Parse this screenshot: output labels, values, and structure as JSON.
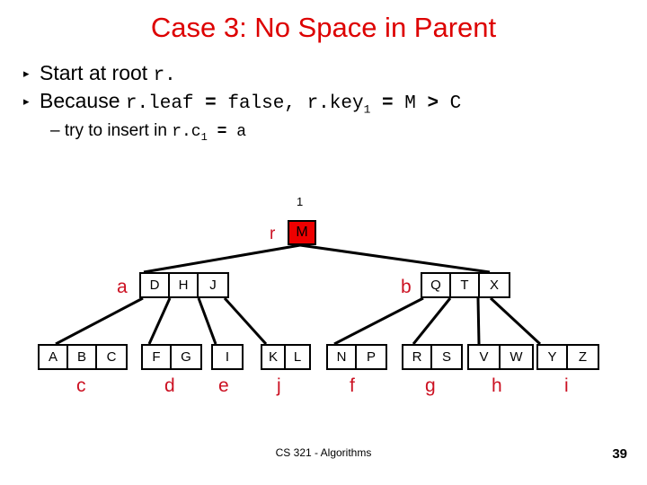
{
  "slide": {
    "title": "Case 3: No Space in Parent",
    "title_color": "#dd0000",
    "footer": "CS 321 - Algorithms",
    "page_number": "39"
  },
  "bullets": [
    {
      "marker": "▸",
      "parts": [
        {
          "text": "Start at root ",
          "style": "plain"
        },
        {
          "text": "r.",
          "style": "mono"
        }
      ]
    },
    {
      "marker": "▸",
      "parts": [
        {
          "text": "Because ",
          "style": "plain"
        },
        {
          "text": "r.leaf ",
          "style": "mono"
        },
        {
          "text": "= ",
          "style": "mono-bold"
        },
        {
          "text": "false,",
          "style": "mono"
        },
        {
          "text": " r.key",
          "style": "mono"
        },
        {
          "text": "1",
          "style": "sub"
        },
        {
          "text": " = ",
          "style": "mono-bold"
        },
        {
          "text": "M ",
          "style": "mono"
        },
        {
          "text": "> ",
          "style": "mono-bold"
        },
        {
          "text": "C",
          "style": "mono"
        }
      ],
      "subbullet": {
        "dash": "–",
        "parts": [
          {
            "text": " try to insert in ",
            "style": "plain"
          },
          {
            "text": "r.c",
            "style": "mono"
          },
          {
            "text": "1",
            "style": "sub"
          },
          {
            "text": " = ",
            "style": "mono-bold"
          },
          {
            "text": "a",
            "style": "mono"
          }
        ]
      }
    }
  ],
  "tree": {
    "counter_label": "1",
    "root": {
      "label": "r",
      "keys": [
        "M"
      ],
      "highlight_color": "#ee0000"
    },
    "internal": [
      {
        "label": "a",
        "keys": [
          "D",
          "H",
          "J"
        ]
      },
      {
        "label": "b",
        "keys": [
          "Q",
          "T",
          "X"
        ]
      }
    ],
    "leaves": [
      {
        "label": "c",
        "keys": [
          "A",
          "B",
          "C"
        ]
      },
      {
        "label": "d",
        "keys": [
          "F",
          "G"
        ]
      },
      {
        "label": "e",
        "keys": [
          "I"
        ]
      },
      {
        "label": "j",
        "keys": [
          "K",
          "L"
        ]
      },
      {
        "label": "f",
        "keys": [
          "N",
          "P"
        ]
      },
      {
        "label": "g",
        "keys": [
          "R",
          "S"
        ]
      },
      {
        "label": "h",
        "keys": [
          "V",
          "W"
        ]
      },
      {
        "label": "i",
        "keys": [
          "Y",
          "Z"
        ]
      }
    ]
  }
}
